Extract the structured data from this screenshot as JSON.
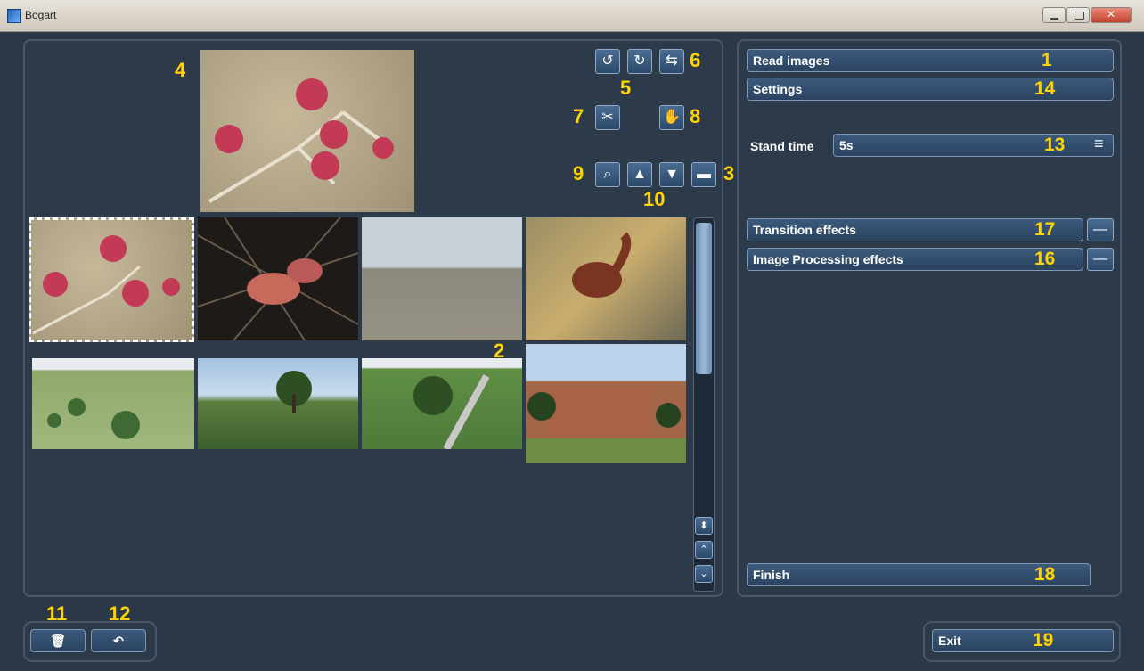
{
  "window": {
    "title": "Bogart"
  },
  "callouts": {
    "c1": "1",
    "c2": "2",
    "c3": "3",
    "c4": "4",
    "c5": "5",
    "c6": "6",
    "c7": "7",
    "c8": "8",
    "c9": "9",
    "c10": "10",
    "c11": "11",
    "c12": "12",
    "c13": "13",
    "c14": "14",
    "c16": "16",
    "c17": "17",
    "c18": "18",
    "c19": "19"
  },
  "right_panel": {
    "read_images": "Read images",
    "settings": "Settings",
    "stand_time_label": "Stand time",
    "stand_time_value": "5s",
    "transition_effects": "Transition effects",
    "image_processing_effects": "Image Processing effects",
    "finish": "Finish"
  },
  "bottom": {
    "exit": "Exit"
  },
  "icons": {
    "rotate_left": "rotate-left-icon",
    "rotate_right": "rotate-right-icon",
    "swap": "swap-icon",
    "cut": "scissors-icon",
    "hand": "hand-icon",
    "zoom": "magnifier-icon",
    "thumb_up": "thumbs-up-icon",
    "thumb_down": "thumbs-down-icon",
    "view": "layout-icon",
    "trash": "trash-icon",
    "undo": "undo-icon",
    "menu": "menu-icon"
  },
  "colors": {
    "accent_callout": "#ffd400",
    "button_blue": "#2f4a68",
    "background": "#2b3847"
  }
}
